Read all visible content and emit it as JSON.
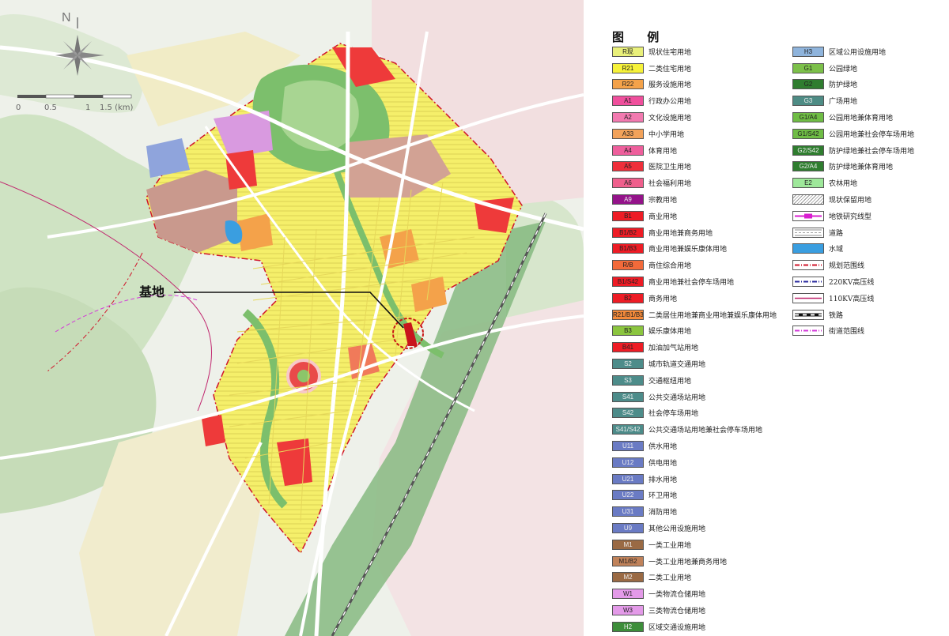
{
  "map": {
    "compass_label": "N",
    "scale_labels": [
      "0",
      "0.5",
      "1",
      "1.5 (km)"
    ],
    "callout_label": "基地"
  },
  "legend": {
    "title": "图 例",
    "left_items": [
      {
        "code": "R现",
        "label": "现状住宅用地",
        "color": "#e9f07a",
        "text_color": "#222"
      },
      {
        "code": "R21",
        "label": "二类住宅用地",
        "color": "#f6f23a",
        "text_color": "#222"
      },
      {
        "code": "R22",
        "label": "服务设施用地",
        "color": "#f4a24a",
        "text_color": "#222"
      },
      {
        "code": "A1",
        "label": "行政办公用地",
        "color": "#ef4f9c",
        "text_color": "#222"
      },
      {
        "code": "A2",
        "label": "文化设施用地",
        "color": "#f27ab0",
        "text_color": "#222"
      },
      {
        "code": "A33",
        "label": "中小学用地",
        "color": "#f2a25a",
        "text_color": "#222"
      },
      {
        "code": "A4",
        "label": "体育用地",
        "color": "#ee5f9c",
        "text_color": "#222"
      },
      {
        "code": "A5",
        "label": "医院卫生用地",
        "color": "#ee2f3a",
        "text_color": "#222"
      },
      {
        "code": "A6",
        "label": "社会福利用地",
        "color": "#ef5f8c",
        "text_color": "#222"
      },
      {
        "code": "A9",
        "label": "宗教用地",
        "color": "#94138a",
        "text_color": "#eee"
      },
      {
        "code": "B1",
        "label": "商业用地",
        "color": "#ee1c25",
        "text_color": "#222"
      },
      {
        "code": "B1/B2",
        "label": "商业用地兼商务用地",
        "color": "#ee1c25",
        "text_color": "#222"
      },
      {
        "code": "B1/B3",
        "label": "商业用地兼娱乐康体用地",
        "color": "#ee1c25",
        "text_color": "#222"
      },
      {
        "code": "R/B",
        "label": "商住综合用地",
        "color": "#f26a3a",
        "text_color": "#222"
      },
      {
        "code": "B1/S42",
        "label": "商业用地兼社会停车场用地",
        "color": "#ee1c25",
        "text_color": "#222"
      },
      {
        "code": "B2",
        "label": "商务用地",
        "color": "#ee1c25",
        "text_color": "#222"
      },
      {
        "code": "R21/B1/B3",
        "label": "二类居住用地兼商业用地兼娱乐康体用地",
        "color": "#f48a3a",
        "text_color": "#222"
      },
      {
        "code": "B3",
        "label": "娱乐康体用地",
        "color": "#8bc53f",
        "text_color": "#222"
      },
      {
        "code": "B41",
        "label": "加油加气站用地",
        "color": "#ee1c25",
        "text_color": "#222"
      },
      {
        "code": "S2",
        "label": "城市轨道交通用地",
        "color": "#4d8c8a",
        "text_color": "#eee"
      },
      {
        "code": "S3",
        "label": "交通枢纽用地",
        "color": "#4d8c8a",
        "text_color": "#eee"
      },
      {
        "code": "S41",
        "label": "公共交通场站用地",
        "color": "#4d8c8a",
        "text_color": "#eee"
      },
      {
        "code": "S42",
        "label": "社会停车场用地",
        "color": "#4d8c8a",
        "text_color": "#eee"
      },
      {
        "code": "S41/S42",
        "label": "公共交通场站用地兼社会停车场用地",
        "color": "#4d8c8a",
        "text_color": "#eee"
      },
      {
        "code": "U11",
        "label": "供水用地",
        "color": "#6a7bc4",
        "text_color": "#eee"
      },
      {
        "code": "U12",
        "label": "供电用地",
        "color": "#6a7bc4",
        "text_color": "#eee"
      },
      {
        "code": "U21",
        "label": "排水用地",
        "color": "#6a7bc4",
        "text_color": "#eee"
      },
      {
        "code": "U22",
        "label": "环卫用地",
        "color": "#6a7bc4",
        "text_color": "#eee"
      },
      {
        "code": "U31",
        "label": "消防用地",
        "color": "#6a7bc4",
        "text_color": "#eee"
      },
      {
        "code": "U9",
        "label": "其他公用设施用地",
        "color": "#6a7bc4",
        "text_color": "#eee"
      },
      {
        "code": "M1",
        "label": "一类工业用地",
        "color": "#9a6a44",
        "text_color": "#eee"
      },
      {
        "code": "M1/B2",
        "label": "一类工业用地兼商务用地",
        "color": "#c0825a",
        "text_color": "#222"
      },
      {
        "code": "M2",
        "label": "二类工业用地",
        "color": "#9a6a44",
        "text_color": "#eee"
      },
      {
        "code": "W1",
        "label": "一类物流仓储用地",
        "color": "#e39ae8",
        "text_color": "#222"
      },
      {
        "code": "W3",
        "label": "三类物流仓储用地",
        "color": "#e39ae8",
        "text_color": "#222"
      },
      {
        "code": "H2",
        "label": "区域交通设施用地",
        "color": "#3d8e3a",
        "text_color": "#eee"
      }
    ],
    "right_items": [
      {
        "code": "H3",
        "label": "区域公用设施用地",
        "color": "#8fb4dc",
        "text_color": "#222",
        "kind": "fill"
      },
      {
        "code": "G1",
        "label": "公园绿地",
        "color": "#7cc04a",
        "text_color": "#222",
        "kind": "fill"
      },
      {
        "code": "G2",
        "label": "防护绿地",
        "color": "#2f7d2f",
        "text_color": "#222",
        "kind": "fill"
      },
      {
        "code": "G3",
        "label": "广场用地",
        "color": "#4e8c85",
        "text_color": "#eee",
        "kind": "fill"
      },
      {
        "code": "G1/A4",
        "label": "公园用地兼体育用地",
        "color": "#6fbd45",
        "text_color": "#222",
        "kind": "fill"
      },
      {
        "code": "G1/S42",
        "label": "公园用地兼社会停车场用地",
        "color": "#6fbd45",
        "text_color": "#222",
        "kind": "fill"
      },
      {
        "code": "G2/S42",
        "label": "防护绿地兼社会停车场用地",
        "color": "#2f7d2f",
        "text_color": "#eee",
        "kind": "fill"
      },
      {
        "code": "G2/A4",
        "label": "防护绿地兼体育用地",
        "color": "#2f7d2f",
        "text_color": "#eee",
        "kind": "fill"
      },
      {
        "code": "E2",
        "label": "农林用地",
        "color": "#9ee89a",
        "text_color": "#222",
        "kind": "fill"
      },
      {
        "code": "",
        "label": "现状保留用地",
        "color": "#ffffff",
        "text_color": "#222",
        "kind": "hatch"
      },
      {
        "code": "",
        "label": "地铁研究线型",
        "color": "#d81ecf",
        "text_color": "#222",
        "kind": "metro"
      },
      {
        "code": "",
        "label": "道路",
        "color": "#ffffff",
        "text_color": "#222",
        "kind": "road"
      },
      {
        "code": "",
        "label": "水域",
        "color": "#3a9ee0",
        "text_color": "#222",
        "kind": "fill"
      },
      {
        "code": "",
        "label": "规划范围线",
        "color": "#d0142a",
        "text_color": "#222",
        "kind": "dashdot"
      },
      {
        "code": "",
        "label": "220KV高压线",
        "color": "#2a2a9e",
        "text_color": "#222",
        "kind": "dashdot"
      },
      {
        "code": "",
        "label": "110KV高压线",
        "color": "#c0266e",
        "text_color": "#222",
        "kind": "solid"
      },
      {
        "code": "",
        "label": "铁路",
        "color": "#111111",
        "text_color": "#222",
        "kind": "rail"
      },
      {
        "code": "",
        "label": "街道范围线",
        "color": "#d33ad9",
        "text_color": "#222",
        "kind": "dashdot"
      }
    ]
  }
}
